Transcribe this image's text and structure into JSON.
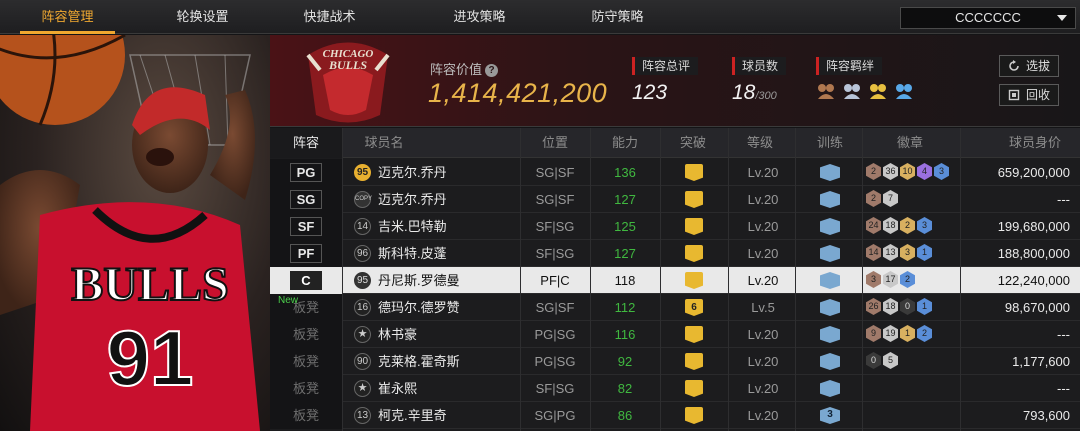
{
  "nav": {
    "tabs": [
      "阵容管理",
      "轮换设置",
      "快捷战术",
      "进攻策略",
      "防守策略"
    ],
    "active_index": 0,
    "team_select": "CCCCCCC"
  },
  "hero": {
    "jersey_text": "BULLS",
    "jersey_number": "91"
  },
  "header": {
    "logo_text": "CHICAGO BULLS",
    "value_label": "阵容价值",
    "value": "1,414,421,200",
    "overall_label": "阵容总评",
    "overall": "123",
    "count_label": "球员数",
    "count": "18",
    "count_max": "/300",
    "bonds_label": "阵容羁绊",
    "bond_icons": [
      "bond-bronze-icon",
      "bond-silver-icon",
      "bond-gold-icon",
      "bond-blue-icon"
    ],
    "btn_scout": "选拔",
    "btn_recycle": "回收"
  },
  "table": {
    "headers": [
      "阵容",
      "球员名",
      "位置",
      "能力",
      "突破",
      "等级",
      "训练",
      "徽章",
      "球员身价"
    ],
    "rows": [
      {
        "slot": "PG",
        "is_starter": true,
        "num": "95",
        "num_style": "gold",
        "name": "迈克尔.乔丹",
        "pos": "SG|SF",
        "ability": "136",
        "breakthrough": "",
        "level": "Lv.20",
        "training": "",
        "badges": [
          [
            "2",
            "bronze"
          ],
          [
            "36",
            "silver"
          ],
          [
            "10",
            "gold"
          ],
          [
            "4",
            "purple"
          ],
          [
            "3",
            "blue"
          ]
        ],
        "value": "659,200,000"
      },
      {
        "slot": "SG",
        "is_starter": true,
        "num": "COPY",
        "num_style": "copy",
        "name": "迈克尔.乔丹",
        "pos": "SG|SF",
        "ability": "127",
        "breakthrough": "",
        "level": "Lv.20",
        "training": "",
        "badges": [
          [
            "2",
            "bronze"
          ],
          [
            "7",
            "silver"
          ]
        ],
        "value": "---"
      },
      {
        "slot": "SF",
        "is_starter": true,
        "num": "14",
        "num_style": "plain",
        "name": "吉米.巴特勒",
        "pos": "SF|SG",
        "ability": "125",
        "breakthrough": "",
        "level": "Lv.20",
        "training": "",
        "badges": [
          [
            "24",
            "bronze"
          ],
          [
            "18",
            "silver"
          ],
          [
            "2",
            "gold"
          ],
          [
            "3",
            "blue"
          ]
        ],
        "value": "199,680,000"
      },
      {
        "slot": "PF",
        "is_starter": true,
        "num": "96",
        "num_style": "plain",
        "name": "斯科特.皮蓬",
        "pos": "SF|SG",
        "ability": "127",
        "breakthrough": "",
        "level": "Lv.20",
        "training": "",
        "badges": [
          [
            "14",
            "bronze"
          ],
          [
            "13",
            "silver"
          ],
          [
            "3",
            "gold"
          ],
          [
            "1",
            "blue"
          ]
        ],
        "value": "188,800,000"
      },
      {
        "slot": "C",
        "is_starter": true,
        "num": "95",
        "num_style": "plain",
        "name": "丹尼斯.罗德曼",
        "pos": "PF|C",
        "ability": "118",
        "breakthrough": "",
        "level": "Lv.20",
        "training": "",
        "badges": [
          [
            "3",
            "bronze"
          ],
          [
            "17",
            "silver"
          ],
          [
            "2",
            "blue"
          ]
        ],
        "value": "122,240,000",
        "selected": true
      },
      {
        "slot": "板凳",
        "is_starter": false,
        "is_new": true,
        "new_label": "New",
        "num": "16",
        "num_style": "plain",
        "name": "德玛尔.德罗赞",
        "pos": "SG|SF",
        "ability": "112",
        "breakthrough": "6",
        "level": "Lv.5",
        "training": "",
        "badges": [
          [
            "26",
            "bronze"
          ],
          [
            "18",
            "silver"
          ],
          [
            "0",
            "dark"
          ],
          [
            "1",
            "blue"
          ]
        ],
        "value": "98,670,000"
      },
      {
        "slot": "板凳",
        "is_starter": false,
        "num": "★",
        "num_style": "star",
        "name": "林书豪",
        "pos": "PG|SG",
        "ability": "116",
        "breakthrough": "",
        "level": "Lv.20",
        "training": "",
        "badges": [
          [
            "9",
            "bronze"
          ],
          [
            "19",
            "silver"
          ],
          [
            "1",
            "gold"
          ],
          [
            "2",
            "blue"
          ]
        ],
        "value": "---"
      },
      {
        "slot": "板凳",
        "is_starter": false,
        "num": "90",
        "num_style": "plain",
        "name": "克莱格.霍奇斯",
        "pos": "PG|SG",
        "ability": "92",
        "breakthrough": "",
        "level": "Lv.20",
        "training": "",
        "badges": [
          [
            "0",
            "dark"
          ],
          [
            "5",
            "silver"
          ]
        ],
        "value": "1,177,600"
      },
      {
        "slot": "板凳",
        "is_starter": false,
        "num": "★",
        "num_style": "star",
        "name": "崔永熙",
        "pos": "SF|SG",
        "ability": "82",
        "breakthrough": "",
        "level": "Lv.20",
        "training": "",
        "badges": [],
        "value": "---"
      },
      {
        "slot": "板凳",
        "is_starter": false,
        "num": "13",
        "num_style": "plain",
        "name": "柯克.辛里奇",
        "pos": "SG|PG",
        "ability": "86",
        "breakthrough": "",
        "level": "Lv.20",
        "training": "3",
        "badges": [],
        "value": "793,600"
      }
    ]
  },
  "colors": {
    "accent": "#f0a830",
    "ability_green": "#40b840",
    "bulls_red": "#c8102e"
  }
}
